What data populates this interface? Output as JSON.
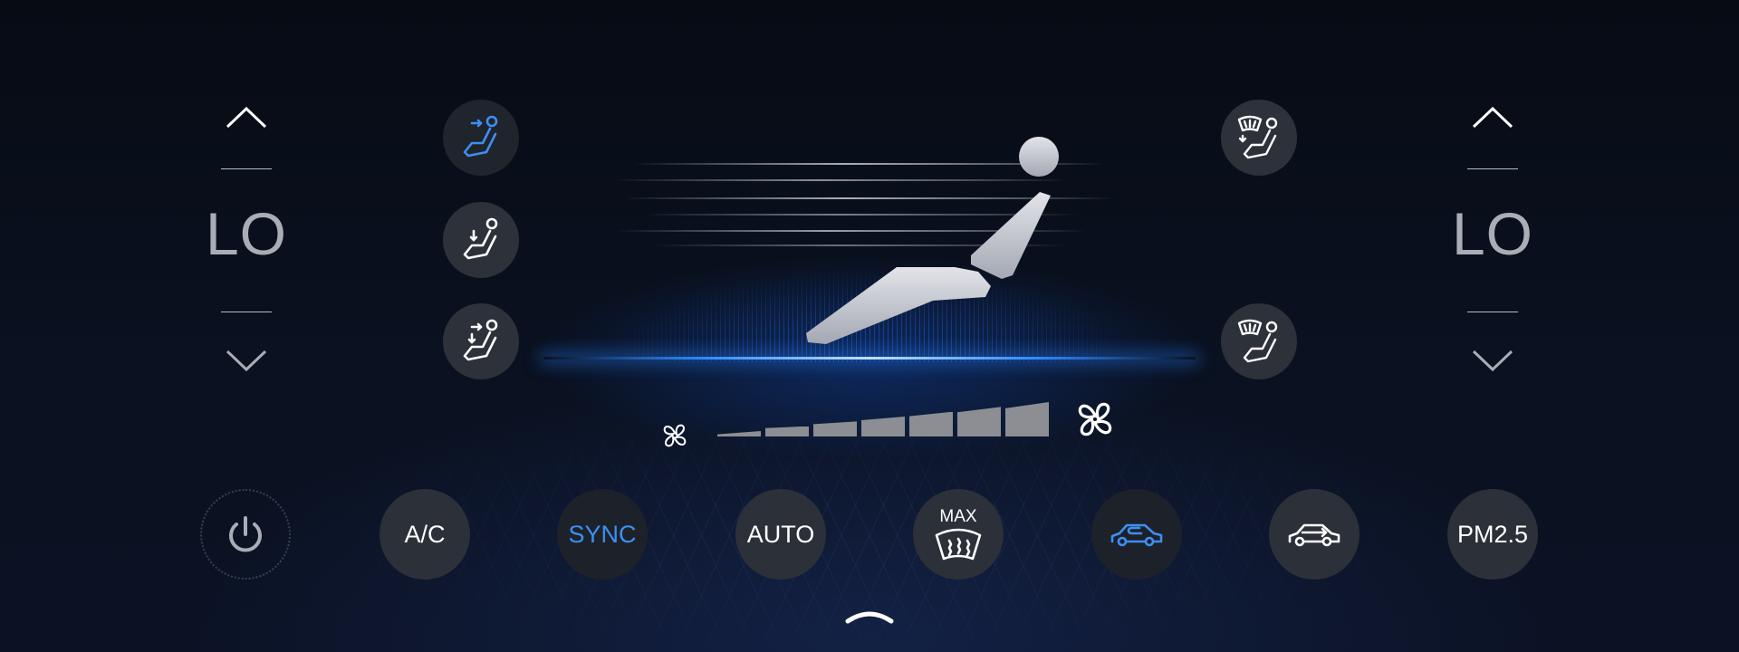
{
  "left_zone": {
    "temperature": "LO",
    "up_icon": "chevron-up-icon",
    "down_icon": "chevron-down-icon"
  },
  "right_zone": {
    "temperature": "LO",
    "up_icon": "chevron-up-icon",
    "down_icon": "chevron-down-icon"
  },
  "left_airflow_modes": [
    {
      "icon": "seat-face-airflow-icon",
      "active": true
    },
    {
      "icon": "seat-foot-airflow-icon",
      "active": false
    },
    {
      "icon": "seat-face-foot-airflow-icon",
      "active": false
    }
  ],
  "right_airflow_modes": [
    {
      "icon": "seat-defrost-foot-airflow-icon",
      "active": false
    },
    {
      "icon": "seat-defrost-airflow-icon",
      "active": false
    }
  ],
  "fan_speed": {
    "level": 7,
    "max_level": 7,
    "low_icon": "fan-low-icon",
    "high_icon": "fan-high-icon"
  },
  "bottom_controls": {
    "power_icon": "power-icon",
    "ac_label": "A/C",
    "sync_label": "SYNC",
    "auto_label": "AUTO",
    "max_defrost_label": "MAX",
    "max_defrost_icon": "windshield-defrost-icon",
    "recirculation_icon": "car-recirculation-icon",
    "fresh_air_icon": "car-fresh-air-icon",
    "pm25_label": "PM2.5"
  },
  "handle_icon": "chevron-up-handle-icon",
  "colors": {
    "accent_blue": "#3d8ff2",
    "button_bg": "#2c3039",
    "button_bg_active": "#1d212a",
    "temp_text": "#a9adb6",
    "fan_bar": "#8c8e93"
  }
}
